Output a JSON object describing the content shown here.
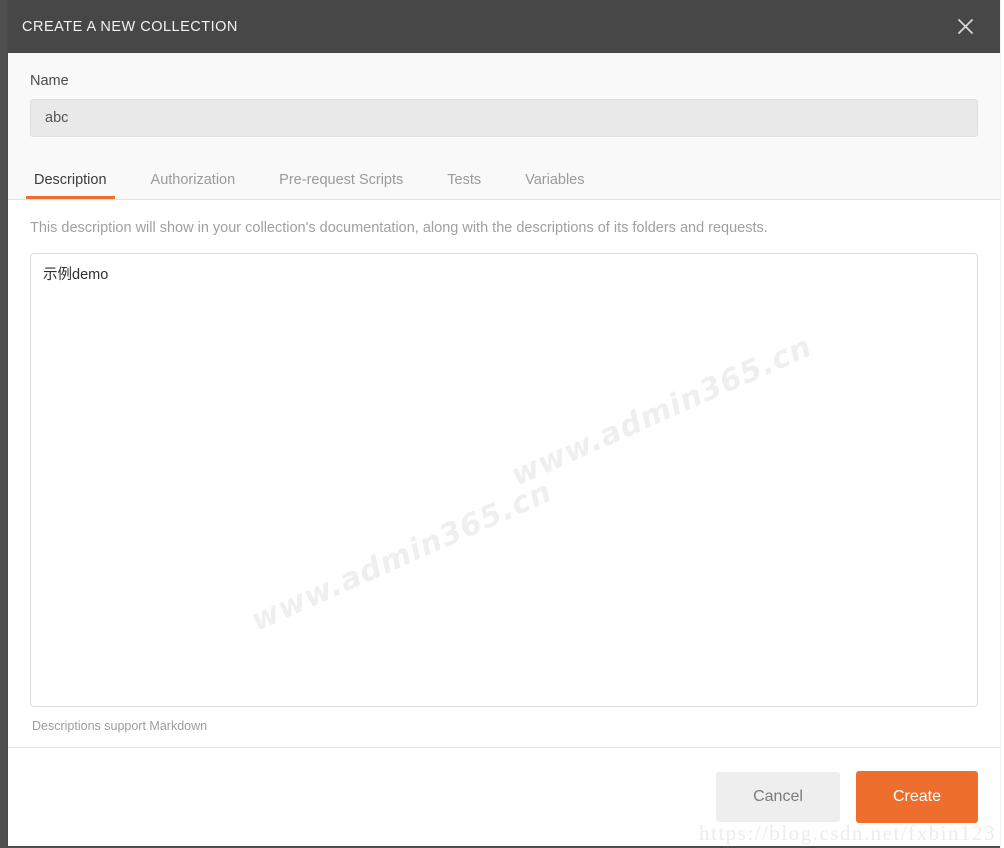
{
  "modal": {
    "title": "CREATE A NEW COLLECTION",
    "close_icon": "close-icon"
  },
  "form": {
    "name_label": "Name",
    "name_value": "abc",
    "name_placeholder": "Name"
  },
  "tabs": [
    {
      "label": "Description",
      "active": true
    },
    {
      "label": "Authorization",
      "active": false
    },
    {
      "label": "Pre-request Scripts",
      "active": false
    },
    {
      "label": "Tests",
      "active": false
    },
    {
      "label": "Variables",
      "active": false
    }
  ],
  "description_panel": {
    "hint": "This description will show in your collection's documentation, along with the descriptions of its folders and requests.",
    "textarea_value": "示例demo",
    "textarea_placeholder": "",
    "markdown_note": "Descriptions support Markdown"
  },
  "footer": {
    "cancel_label": "Cancel",
    "create_label": "Create"
  },
  "watermarks": {
    "site": "www.admin365.cn",
    "blog": "https://blog.csdn.net/fxbin123"
  },
  "colors": {
    "accent": "#ee6f2d",
    "header_bg": "#474747",
    "upper_bg": "#f9f9f9",
    "input_bg": "#e9e9e9"
  }
}
